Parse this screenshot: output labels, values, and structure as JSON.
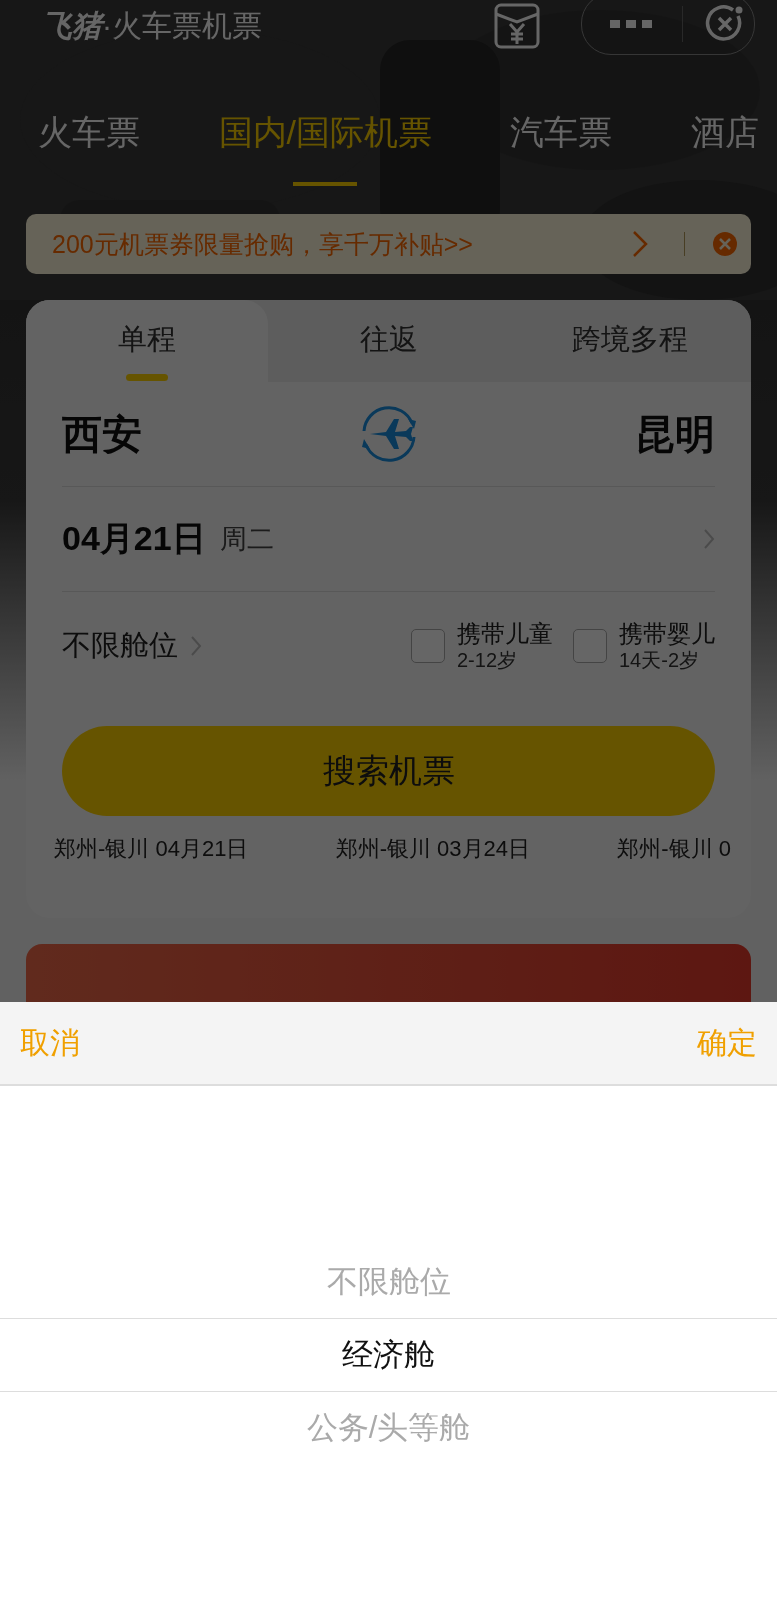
{
  "header": {
    "logo": "飞猪",
    "title": "·火车票机票"
  },
  "tabs": [
    {
      "label": "火车票",
      "selected": false
    },
    {
      "label": "国内/国际机票",
      "selected": true
    },
    {
      "label": "汽车票",
      "selected": false
    },
    {
      "label": "酒店",
      "selected": false
    }
  ],
  "promo": {
    "text": "200元机票券限量抢购，享千万补贴>>"
  },
  "trip_tabs": [
    {
      "label": "单程",
      "selected": true
    },
    {
      "label": "往返",
      "selected": false
    },
    {
      "label": "跨境多程",
      "selected": false
    }
  ],
  "route": {
    "from": "西安",
    "to": "昆明"
  },
  "date": {
    "date": "04月21日",
    "weekday": "周二"
  },
  "cabin": "不限舱位",
  "options": [
    {
      "label": "携带儿童",
      "note": "2-12岁",
      "checked": false
    },
    {
      "label": "携带婴儿",
      "note": "14天-2岁",
      "checked": false
    }
  ],
  "search_button": "搜索机票",
  "history": [
    "郑州-银川 04月21日",
    "郑州-银川 03月24日",
    "郑州-银川 0"
  ],
  "sheet": {
    "cancel": "取消",
    "confirm": "确定",
    "items": [
      {
        "label": "不限舱位",
        "selected": false
      },
      {
        "label": "经济舱",
        "selected": true
      },
      {
        "label": "公务/头等舱",
        "selected": false
      }
    ]
  }
}
